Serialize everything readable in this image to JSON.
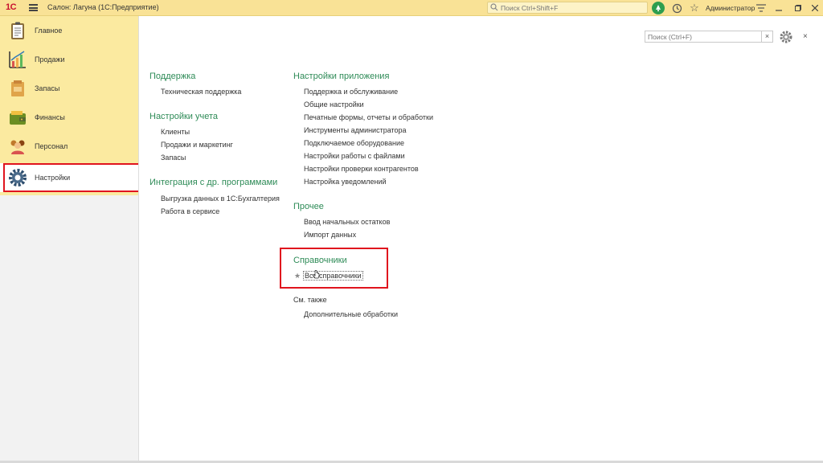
{
  "titlebar": {
    "logo": "1С",
    "title": "Салон: Лагуна  (1С:Предприятие)",
    "search_placeholder": "Поиск Ctrl+Shift+F",
    "user": "Администратор"
  },
  "sidebar": {
    "items": [
      {
        "label": "Главное",
        "icon": "clipboard-icon"
      },
      {
        "label": "Продажи",
        "icon": "chart-icon"
      },
      {
        "label": "Запасы",
        "icon": "box-icon"
      },
      {
        "label": "Финансы",
        "icon": "wallet-icon"
      },
      {
        "label": "Персонал",
        "icon": "people-icon"
      },
      {
        "label": "Настройки",
        "icon": "gear-icon"
      }
    ],
    "active_index": 5
  },
  "panel": {
    "search_placeholder": "Поиск (Ctrl+F)",
    "clear": "×",
    "close": "×"
  },
  "left_column": {
    "support": {
      "title": "Поддержка",
      "links": [
        "Техническая поддержка"
      ]
    },
    "accounting": {
      "title": "Настройки учета",
      "links": [
        "Клиенты",
        "Продажи и маркетинг",
        "Запасы"
      ]
    },
    "integration": {
      "title": "Интеграция с др. программами",
      "links": [
        "Выгрузка данных в 1С:Бухгалтерия",
        "Работа в сервисе"
      ]
    }
  },
  "right_column": {
    "app_settings": {
      "title": "Настройки приложения",
      "links": [
        "Поддержка и обслуживание",
        "Общие настройки",
        "Печатные формы, отчеты и обработки",
        "Инструменты администратора",
        "Подключаемое оборудование",
        "Настройки работы с файлами",
        "Настройки проверки контрагентов",
        "Настройка уведомлений"
      ]
    },
    "other": {
      "title": "Прочее",
      "links": [
        "Ввод начальных остатков",
        "Импорт данных"
      ]
    },
    "catalogs": {
      "title": "Справочники",
      "star": "★",
      "links": [
        "Все справочники"
      ]
    },
    "see_also": {
      "title": "См. также",
      "links": [
        "Дополнительные обработки"
      ]
    }
  },
  "colors": {
    "accent_green": "#2e8b57",
    "sidebar_bg": "#fbeaa0",
    "highlight_red": "#e0141e"
  }
}
